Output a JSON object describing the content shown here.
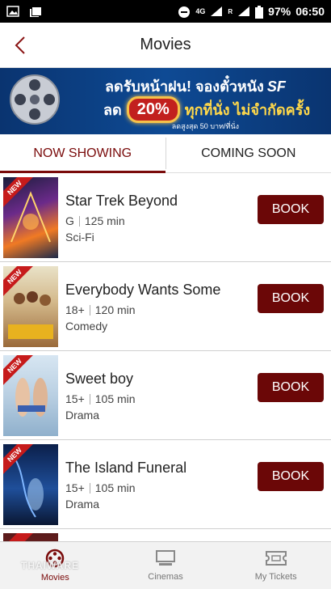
{
  "status_bar": {
    "network": "4G",
    "roaming": "R",
    "battery": "97%",
    "time": "06:50"
  },
  "header": {
    "title": "Movies",
    "back_icon": "chevron-left-icon"
  },
  "banner": {
    "line1": "ลดรับหน้าฝน! จองตั๋วหนัง",
    "brand": "SF",
    "line2_prefix": "ลด",
    "discount": "20%",
    "line2_suffix": "ทุกที่นั่ง ไม่จำกัดครั้ง",
    "note": "ลดสูงสุด 50 บาท/ที่นั่ง"
  },
  "tabs": [
    {
      "label": "NOW SHOWING",
      "active": true
    },
    {
      "label": "COMING SOON",
      "active": false
    }
  ],
  "movies": [
    {
      "title": "Star Trek Beyond",
      "rating": "G",
      "runtime": "125 min",
      "genre": "Sci-Fi",
      "badge": "NEW",
      "book_label": "BOOK"
    },
    {
      "title": "Everybody Wants Some",
      "rating": "18+",
      "runtime": "120 min",
      "genre": "Comedy",
      "badge": "NEW",
      "book_label": "BOOK"
    },
    {
      "title": "Sweet boy",
      "rating": "15+",
      "runtime": "105 min",
      "genre": "Drama",
      "badge": "NEW",
      "book_label": "BOOK"
    },
    {
      "title": "The Island Funeral",
      "rating": "15+",
      "runtime": "105 min",
      "genre": "Drama",
      "badge": "NEW",
      "book_label": "BOOK"
    }
  ],
  "bottom_nav": [
    {
      "label": "Movies",
      "icon": "film-reel-icon",
      "active": true
    },
    {
      "label": "Cinemas",
      "icon": "cinema-screen-icon",
      "active": false
    },
    {
      "label": "My Tickets",
      "icon": "ticket-icon",
      "active": false
    }
  ],
  "watermark": "THAIWARE",
  "colors": {
    "accent": "#7a0b0b",
    "book_button": "#6b0707",
    "banner_bg": "#0e4a94",
    "new_ribbon": "#c61b1b"
  }
}
